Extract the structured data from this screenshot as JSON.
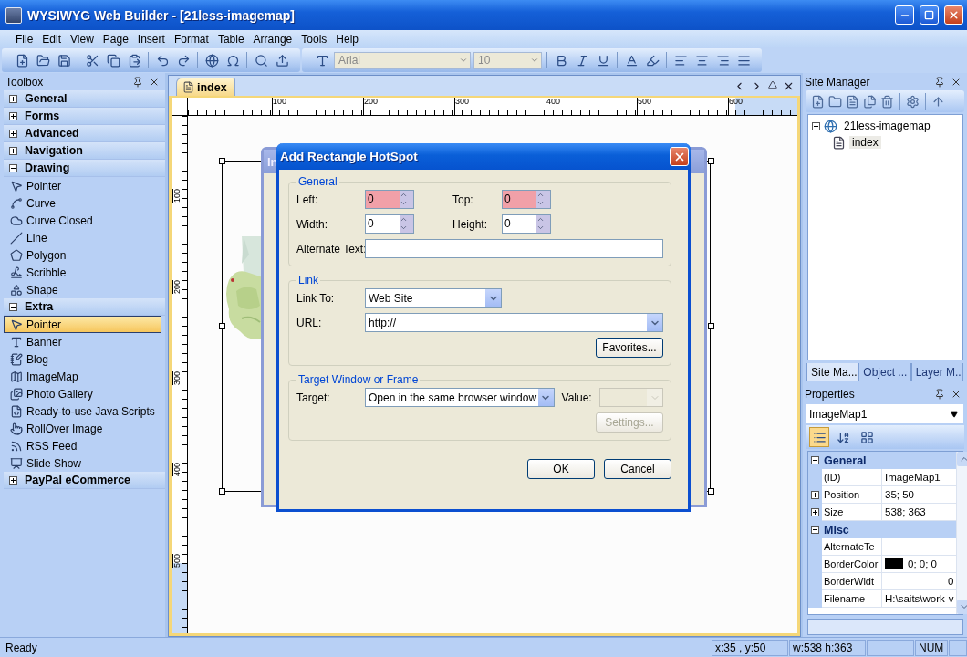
{
  "window": {
    "title": "WYSIWYG Web Builder - [21less-imagemap]"
  },
  "menu": [
    "File",
    "Edit",
    "View",
    "Page",
    "Insert",
    "Format",
    "Table",
    "Arrange",
    "Tools",
    "Help"
  ],
  "toolbar": {
    "font": "Arial",
    "size": "10"
  },
  "toolbox": {
    "title": "Toolbox",
    "groups": [
      {
        "label": "General",
        "expanded": false
      },
      {
        "label": "Forms",
        "expanded": false
      },
      {
        "label": "Advanced",
        "expanded": false
      },
      {
        "label": "Navigation",
        "expanded": false
      },
      {
        "label": "Drawing",
        "expanded": true,
        "items": [
          {
            "label": "Pointer",
            "kind": "pointer",
            "selected": false
          },
          {
            "label": "Curve",
            "kind": "curve",
            "selected": false
          },
          {
            "label": "Curve Closed",
            "kind": "closed",
            "selected": false
          },
          {
            "label": "Line",
            "kind": "line",
            "selected": false
          },
          {
            "label": "Polygon",
            "kind": "polygon",
            "selected": false
          },
          {
            "label": "Scribble",
            "kind": "scribble",
            "selected": false
          },
          {
            "label": "Shape",
            "kind": "shape",
            "selected": false
          }
        ]
      },
      {
        "label": "Extra",
        "expanded": true,
        "items": [
          {
            "label": "Pointer",
            "kind": "pointer",
            "selected": true
          },
          {
            "label": "Banner",
            "kind": "banner",
            "selected": false
          },
          {
            "label": "Blog",
            "kind": "blog",
            "selected": false
          },
          {
            "label": "ImageMap",
            "kind": "imagemap",
            "selected": false
          },
          {
            "label": "Photo Gallery",
            "kind": "gallery",
            "selected": false
          },
          {
            "label": "Ready-to-use Java Scripts",
            "kind": "scripts",
            "selected": false
          },
          {
            "label": "RollOver Image",
            "kind": "rollover",
            "selected": false
          },
          {
            "label": "RSS Feed",
            "kind": "rss",
            "selected": false
          },
          {
            "label": "Slide Show",
            "kind": "slideshow",
            "selected": false
          }
        ]
      },
      {
        "label": "PayPal eCommerce",
        "expanded": false
      }
    ]
  },
  "document": {
    "tab": "index",
    "ruler": {
      "horizontal": [
        "100",
        "200",
        "300",
        "400",
        "500",
        "600"
      ],
      "vertical": [
        "100",
        "200",
        "300",
        "400",
        "500"
      ]
    },
    "background_dialog": {
      "title": "In"
    },
    "dialog": {
      "title": "Add Rectangle HotSpot",
      "general": {
        "legend": "General",
        "left": {
          "label": "Left:",
          "value": "0",
          "invalid": true
        },
        "top": {
          "label": "Top:",
          "value": "0",
          "invalid": true
        },
        "width": {
          "label": "Width:",
          "value": "0",
          "invalid": false
        },
        "height": {
          "label": "Height:",
          "value": "0",
          "invalid": false
        },
        "alternate_text": {
          "label": "Alternate Text:"
        }
      },
      "link": {
        "legend": "Link",
        "link_to": {
          "label": "Link To:",
          "value": "Web Site"
        },
        "url": {
          "label": "URL:",
          "value": "http://"
        },
        "favorites": "Favorites..."
      },
      "target": {
        "legend": "Target Window or Frame",
        "target": {
          "label": "Target:",
          "value": "Open in the same browser window"
        },
        "value": {
          "label": "Value:",
          "disabled": true
        },
        "settings": {
          "label": "Settings...",
          "disabled": true
        }
      },
      "buttons": [
        "OK",
        "Cancel"
      ]
    }
  },
  "site_manager": {
    "title": "Site Manager",
    "tree": [
      {
        "label": "21less-imagemap",
        "expanded": true,
        "selected": false,
        "children": [
          {
            "label": "index",
            "selected": true
          }
        ]
      }
    ],
    "tabs": [
      {
        "label": "Site Ma...",
        "selected": true
      },
      {
        "label": "Object ...",
        "selected": false
      },
      {
        "label": "Layer M...",
        "selected": false
      }
    ]
  },
  "properties": {
    "title": "Properties",
    "object": "ImageMap1",
    "view_modes": [
      {
        "kind": "categorized",
        "selected": true
      },
      {
        "kind": "alphabetical",
        "selected": false
      },
      {
        "kind": "pages",
        "selected": false
      }
    ],
    "rows": [
      {
        "kind": "category",
        "label": "General",
        "expanded": true
      },
      {
        "kind": "property",
        "name": "(ID)",
        "value": "ImageMap1"
      },
      {
        "kind": "property",
        "name": "Position",
        "value": "35; 50",
        "expanded": false
      },
      {
        "kind": "property",
        "name": "Size",
        "value": "538; 363",
        "expanded": false
      },
      {
        "kind": "category",
        "label": "Misc",
        "expanded": true
      },
      {
        "kind": "property",
        "name": "AlternateTe"
      },
      {
        "kind": "property",
        "name": "BorderColor",
        "value": "0; 0; 0",
        "color": "#000000"
      },
      {
        "kind": "number",
        "name": "BorderWidt",
        "value": "0"
      },
      {
        "kind": "property",
        "name": "Filename",
        "value": "H:\\saits\\work-v"
      }
    ]
  },
  "status_bar": {
    "message": "Ready",
    "position": "x:35 , y:50",
    "size": "w:538 h:363",
    "num": "NUM"
  }
}
